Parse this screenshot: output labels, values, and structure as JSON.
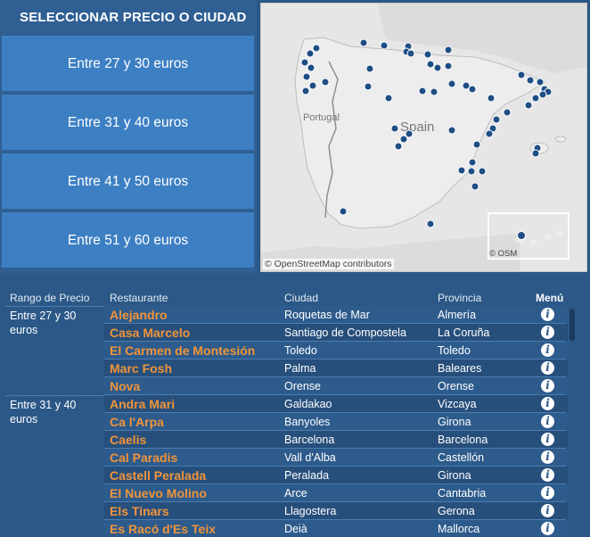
{
  "filter": {
    "title": "SELECCIONAR PRECIO O CIUDAD",
    "buttons": [
      {
        "label": "Entre 27 y 30 euros"
      },
      {
        "label": "Entre 31 y 40 euros"
      },
      {
        "label": "Entre 41 y 50 euros"
      },
      {
        "label": "Entre 51 y 60 euros"
      }
    ]
  },
  "map": {
    "labels": {
      "portugal": "Portugal",
      "spain": "Spain"
    },
    "credit": "© OpenStreetMap contributors",
    "inset_credit": "© OSM",
    "marker_color": "#1f4e85"
  },
  "table": {
    "headers": {
      "range": "Rango de Precio",
      "restaurant": "Restaurante",
      "city": "Ciudad",
      "province": "Provincia",
      "menu": "Menú"
    },
    "groups": [
      {
        "label": "Entre 27 y 30 euros"
      },
      {
        "label": "Entre 31 y 40 euros"
      }
    ],
    "rows": [
      {
        "restaurant": "Alejandro",
        "city": "Roquetas de Mar",
        "province": "Almería"
      },
      {
        "restaurant": "Casa Marcelo",
        "city": "Santiago de Compostela",
        "province": "La Coruña"
      },
      {
        "restaurant": "El Carmen de Montesión",
        "city": "Toledo",
        "province": "Toledo"
      },
      {
        "restaurant": "Marc Fosh",
        "city": "Palma",
        "province": "Baleares"
      },
      {
        "restaurant": "Nova",
        "city": "Orense",
        "province": "Orense"
      },
      {
        "restaurant": "Andra Mari",
        "city": "Galdakao",
        "province": "Vizcaya"
      },
      {
        "restaurant": "Ca l'Arpa",
        "city": "Banyoles",
        "province": "Girona"
      },
      {
        "restaurant": "Caelis",
        "city": "Barcelona",
        "province": "Barcelona"
      },
      {
        "restaurant": "Cal Paradis",
        "city": "Vall d'Alba",
        "province": "Castellón"
      },
      {
        "restaurant": "Castell Peralada",
        "city": "Peralada",
        "province": "Girona"
      },
      {
        "restaurant": "El Nuevo Molino",
        "city": "Arce",
        "province": "Cantabria"
      },
      {
        "restaurant": "Els Tinars",
        "city": "Llagostera",
        "province": "Gerona"
      },
      {
        "restaurant": "Es Racó d'Es Teix",
        "city": "Deià",
        "province": "Mallorca"
      }
    ],
    "menu_icon": "info-icon"
  }
}
